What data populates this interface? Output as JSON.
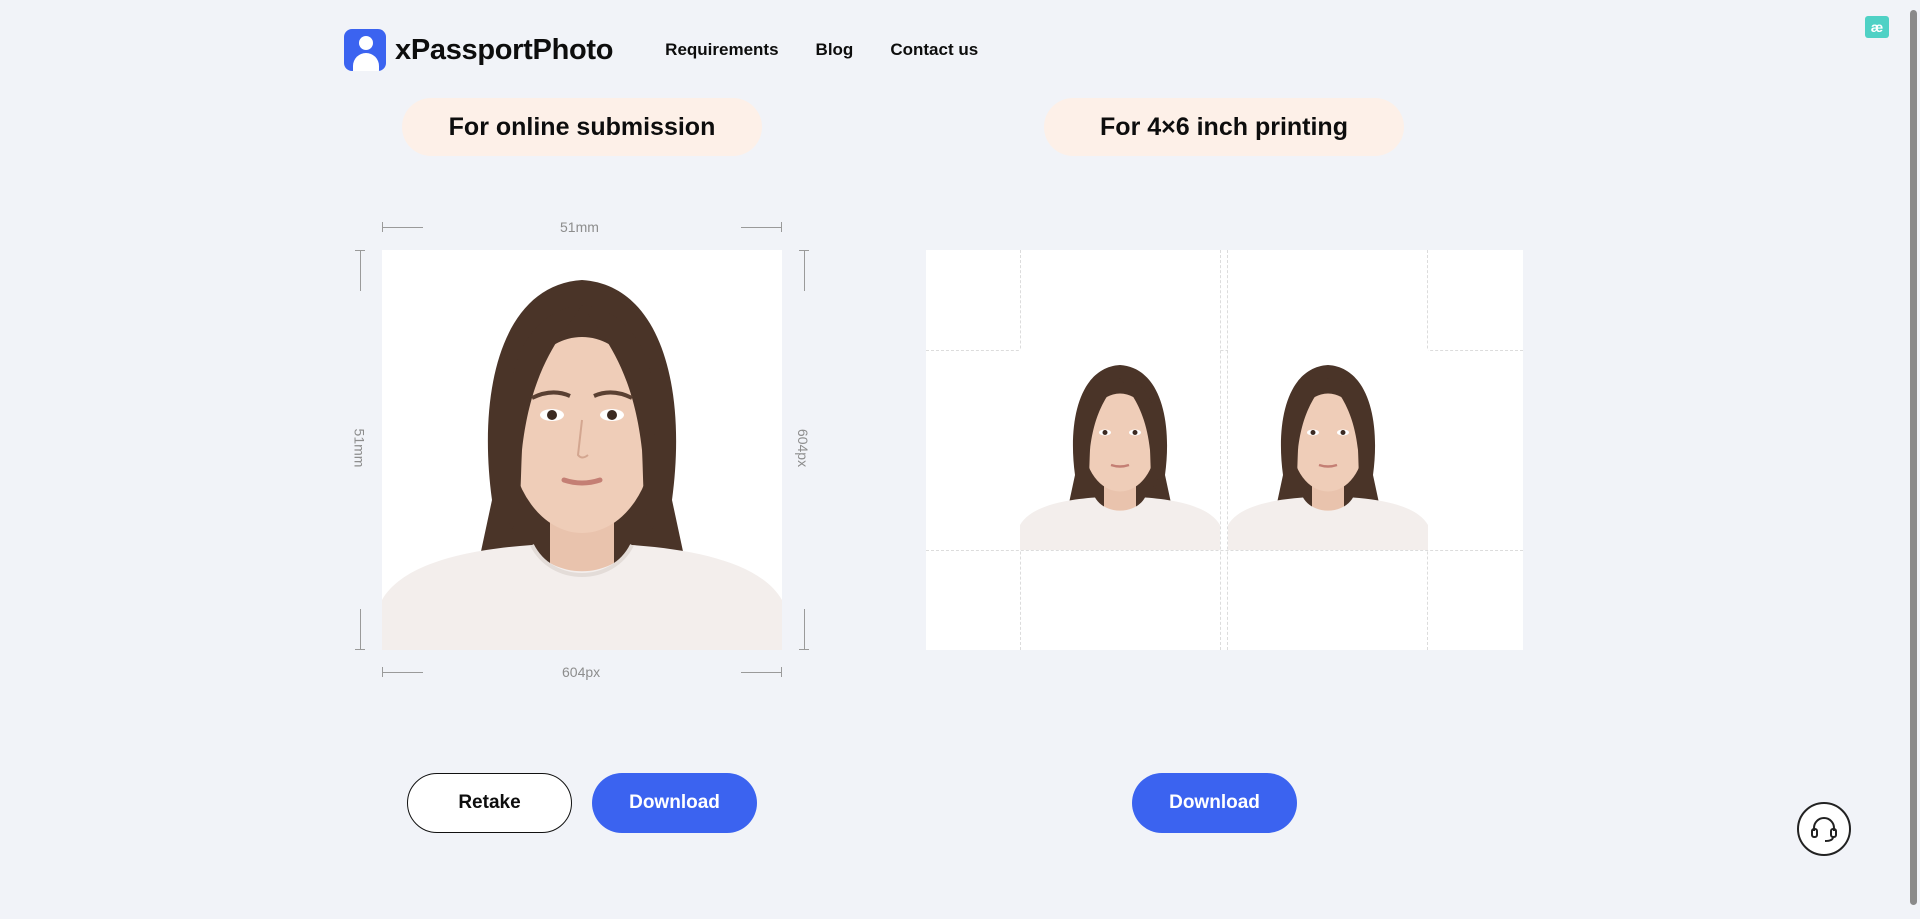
{
  "brand": {
    "name": "xPassportPhoto",
    "accent": "#3b63f0"
  },
  "nav": {
    "items": [
      "Requirements",
      "Blog",
      "Contact us"
    ]
  },
  "badge": {
    "text": "æ"
  },
  "online": {
    "title": "For online submission",
    "width_mm": "51mm",
    "height_mm": "51mm",
    "width_px": "604px",
    "height_px": "604px"
  },
  "print": {
    "title": "For 4×6 inch printing"
  },
  "buttons": {
    "retake": "Retake",
    "download_online": "Download",
    "download_print": "Download"
  },
  "colors": {
    "background": "#f1f3f8",
    "pill": "#fdf0e8",
    "primary": "#3b63f0"
  },
  "icons": {
    "support": "headset-icon",
    "logo": "person-logo-icon"
  }
}
